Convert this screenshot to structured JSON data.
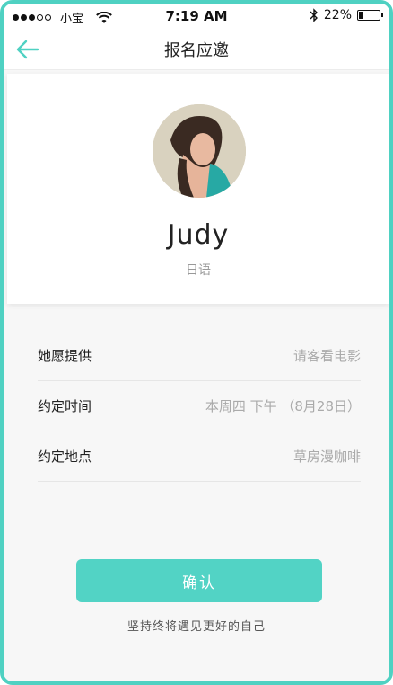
{
  "status_bar": {
    "carrier": "小宝",
    "time": "7:19 AM",
    "battery": "22%",
    "battery_level": 0.22
  },
  "nav": {
    "title": "报名应邀",
    "back_icon": "arrow-left-icon"
  },
  "profile": {
    "name": "Judy",
    "language": "日语"
  },
  "details": [
    {
      "label": "她愿提供",
      "value": "请客看电影"
    },
    {
      "label": "约定时间",
      "value": "本周四 下午 （8月28日）"
    },
    {
      "label": "约定地点",
      "value": "草房漫咖啡"
    }
  ],
  "confirm_label": "确认",
  "slogan": "坚持终将遇见更好的自己",
  "colors": {
    "accent": "#52d3c5",
    "frame": "#4fd1c2"
  }
}
